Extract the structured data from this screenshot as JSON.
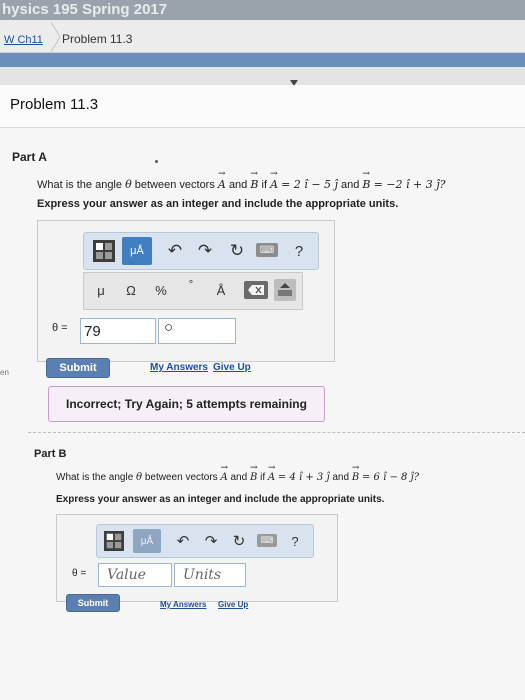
{
  "header": {
    "course_title": "hysics 195 Spring 2017"
  },
  "breadcrumb": {
    "link": "W Ch11",
    "current": "Problem 11.3"
  },
  "problem": {
    "title": "Problem 11.3"
  },
  "partA": {
    "label": "Part A",
    "question_prefix": "What is the angle",
    "theta": "θ",
    "q_between": "between vectors",
    "A": "A",
    "and": "and",
    "B": "B",
    "if": "if",
    "A_expr": "= 2 ı̂ − 5 ȷ̂",
    "and2": "and",
    "B_expr": "= −2 ı̂ + 3 ȷ̂?",
    "instruction": "Express your answer as an integer and include the appropriate units.",
    "toolbar": {
      "mu_a": "μÅ",
      "undo": "↶",
      "redo": "↷",
      "refresh": "↻",
      "keyboard": "⌨",
      "help": "?"
    },
    "symbols": {
      "mu": "μ",
      "omega": "Ω",
      "percent": "%",
      "degree": "°",
      "angstrom": "Å"
    },
    "theta_label": "θ =",
    "value": "79",
    "units": "○",
    "submit": "Submit",
    "my_answers": "My Answers",
    "give_up": "Give Up",
    "feedback": "Incorrect; Try Again; 5 attempts remaining"
  },
  "partB": {
    "label": "Part B",
    "question_prefix": "What is the angle",
    "theta": "θ",
    "q_between": "between vectors",
    "A": "A",
    "and": "and",
    "B": "B",
    "if": "if",
    "A_expr": "= 4 ı̂ + 3 ȷ̂",
    "and2": "and",
    "B_expr": "= 6 ı̂ − 8 ȷ̂?",
    "instruction": "Express your answer as an integer and include the appropriate units.",
    "toolbar": {
      "mu_a": "μÅ",
      "undo": "↶",
      "redo": "↷",
      "refresh": "↻",
      "keyboard": "⌨",
      "help": "?"
    },
    "theta_label": "θ =",
    "value_placeholder": "Value",
    "units_placeholder": "Units",
    "submit": "Submit",
    "my_answers": "My Answers",
    "give_up": "Give Up"
  },
  "side_marker": "en"
}
